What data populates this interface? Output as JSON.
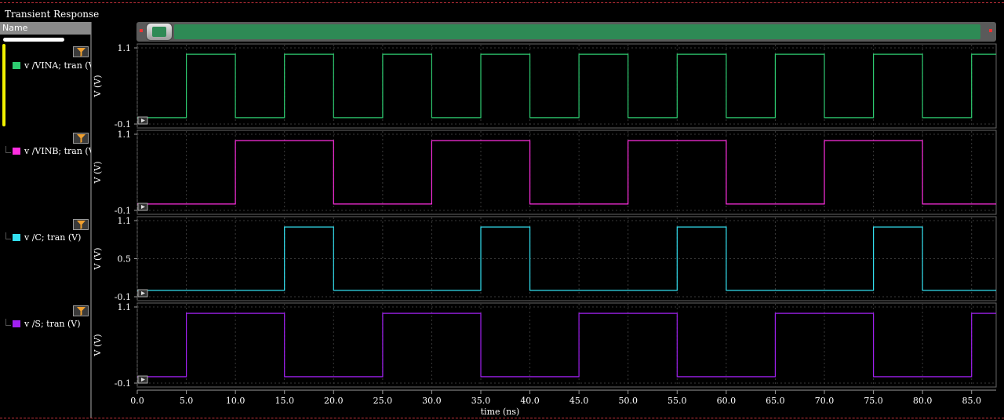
{
  "window": {
    "title": "Transient Response"
  },
  "panel": {
    "name_header": "Name"
  },
  "colors": {
    "background": "#000000",
    "grid": "#3a3a3a",
    "axis": "#9a9a9a"
  },
  "chart_data": {
    "type": "line",
    "xlabel": "time (ns)",
    "xlim": [
      0,
      87.5
    ],
    "xticks": [
      0,
      5,
      10,
      15,
      20,
      25,
      30,
      35,
      40,
      45,
      50,
      55,
      60,
      65,
      70,
      75,
      80,
      85
    ],
    "xtick_labels": [
      "0.0",
      "5.0",
      "10.0",
      "15.0",
      "20.0",
      "25.0",
      "30.0",
      "35.0",
      "40.0",
      "45.0",
      "50.0",
      "55.0",
      "60.0",
      "65.0",
      "70.0",
      "75.0",
      "80.0",
      "85.0"
    ],
    "grid": true,
    "series": [
      {
        "name": "v /VINA; tran (V)",
        "color": "#2ecc71",
        "ylabel": "V (V)",
        "ylim": [
          -0.1,
          1.1
        ],
        "ytick_labels": [
          "1.1",
          "-0.1"
        ],
        "low": 0.0,
        "high": 1.0,
        "x": [
          0,
          5,
          5,
          10,
          10,
          15,
          15,
          20,
          20,
          25,
          25,
          30,
          30,
          35,
          35,
          40,
          40,
          45,
          45,
          50,
          50,
          55,
          55,
          60,
          60,
          65,
          65,
          70,
          70,
          75,
          75,
          80,
          80,
          85,
          85,
          87.5
        ],
        "y": [
          0,
          0,
          1,
          1,
          0,
          0,
          1,
          1,
          0,
          0,
          1,
          1,
          0,
          0,
          1,
          1,
          0,
          0,
          1,
          1,
          0,
          0,
          1,
          1,
          0,
          0,
          1,
          1,
          0,
          0,
          1,
          1,
          0,
          0,
          1,
          1
        ]
      },
      {
        "name": "v /VINB; tran (V)",
        "color": "#ff2ee0",
        "ylabel": "V (V)",
        "ylim": [
          -0.1,
          1.1
        ],
        "ytick_labels": [
          "1.1",
          "-0.1"
        ],
        "low": 0.0,
        "high": 1.0,
        "x": [
          0,
          10,
          10,
          20,
          20,
          30,
          30,
          40,
          40,
          50,
          50,
          60,
          60,
          70,
          70,
          80,
          80,
          87.5
        ],
        "y": [
          0,
          0,
          1,
          1,
          0,
          0,
          1,
          1,
          0,
          0,
          1,
          1,
          0,
          0,
          1,
          1,
          0,
          0
        ]
      },
      {
        "name": "v /C; tran (V)",
        "color": "#33e0f0",
        "ylabel": "V (V)",
        "ylim": [
          -0.1,
          1.1
        ],
        "ytick_labels": [
          "1.1",
          "0.5",
          "-0.1"
        ],
        "low": 0.0,
        "high": 1.0,
        "x": [
          0,
          15,
          15,
          20,
          20,
          35,
          35,
          40,
          40,
          55,
          55,
          60,
          60,
          75,
          75,
          80,
          80,
          87.5
        ],
        "y": [
          0,
          0,
          1,
          1,
          0,
          0,
          1,
          1,
          0,
          0,
          1,
          1,
          0,
          0,
          1,
          1,
          0,
          0
        ]
      },
      {
        "name": "v /S; tran (V)",
        "color": "#a020f0",
        "ylabel": "V (V)",
        "ylim": [
          -0.1,
          1.1
        ],
        "ytick_labels": [
          "1.1",
          "-0.1"
        ],
        "low": 0.0,
        "high": 1.0,
        "x": [
          0,
          5,
          5,
          15,
          15,
          25,
          25,
          35,
          35,
          45,
          45,
          55,
          55,
          65,
          65,
          75,
          75,
          85,
          85,
          87.5
        ],
        "y": [
          0,
          0,
          1,
          1,
          0,
          0,
          1,
          1,
          0,
          0,
          1,
          1,
          0,
          0,
          1,
          1,
          0,
          0,
          1,
          1
        ]
      }
    ]
  }
}
